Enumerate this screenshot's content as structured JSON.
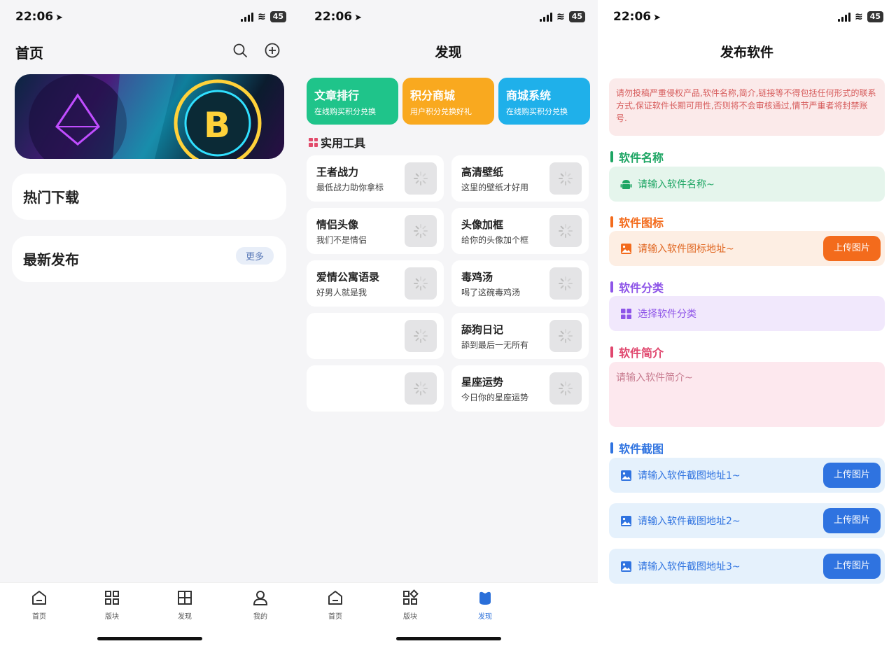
{
  "status": {
    "time": "22:06",
    "battery": "45"
  },
  "home": {
    "title": "首页",
    "sections": [
      {
        "title": "热门下载",
        "more": ""
      },
      {
        "title": "最新发布",
        "more": "更多"
      }
    ],
    "tabs": [
      {
        "label": "首页"
      },
      {
        "label": "版块"
      },
      {
        "label": "发现"
      },
      {
        "label": "我的"
      }
    ]
  },
  "discover": {
    "title": "发现",
    "tiles": [
      {
        "title": "文章排行",
        "sub": "在线购买积分兑换",
        "color": "#1fc48a"
      },
      {
        "title": "积分商城",
        "sub": "用户积分兑换好礼",
        "color": "#f9a91f"
      },
      {
        "title": "商城系统",
        "sub": "在线购买积分兑换",
        "color": "#1fb0ea"
      }
    ],
    "section_title": "实用工具",
    "tools": [
      {
        "name": "王者战力",
        "desc": "最低战力助你拿标"
      },
      {
        "name": "高清壁纸",
        "desc": "这里的壁纸才好用"
      },
      {
        "name": "情侣头像",
        "desc": "我们不是情侣"
      },
      {
        "name": "头像加框",
        "desc": "给你的头像加个框"
      },
      {
        "name": "爱情公寓语录",
        "desc": "好男人就是我"
      },
      {
        "name": "毒鸡汤",
        "desc": "喝了这碗毒鸡汤"
      },
      {
        "name": "",
        "desc": ""
      },
      {
        "name": "舔狗日记",
        "desc": "舔到最后一无所有"
      },
      {
        "name": "",
        "desc": ""
      },
      {
        "name": "星座运势",
        "desc": "今日你的星座运势"
      }
    ],
    "tabs": [
      {
        "label": "首页"
      },
      {
        "label": "版块"
      },
      {
        "label": "发现"
      }
    ]
  },
  "publish": {
    "title": "发布软件",
    "warning": "请勿投稿严重侵权产品,软件名称,简介,链接等不得包括任何形式的联系方式,保证软件长期可用性,否则将不会审核通过,情节严重者将封禁账号.",
    "name_label": "软件名称",
    "name_placeholder": "请输入软件名称~",
    "icon_label": "软件图标",
    "icon_placeholder": "请输入软件图标地址~",
    "upload_label": "上传图片",
    "category_label": "软件分类",
    "category_placeholder": "选择软件分类",
    "intro_label": "软件简介",
    "intro_placeholder": "请输入软件简介~",
    "screenshots_label": "软件截图",
    "shots": [
      {
        "placeholder": "请输入软件截图地址1~",
        "button": "上传图片"
      },
      {
        "placeholder": "请输入软件截图地址2~",
        "button": "上传图片"
      },
      {
        "placeholder": "请输入软件截图地址3~",
        "button": "上传图片"
      }
    ],
    "colors": {
      "green": "#1da563",
      "orange": "#f36b1c",
      "purple": "#8e55e8",
      "pink": "#e0476e",
      "blue": "#2f73e0"
    }
  }
}
